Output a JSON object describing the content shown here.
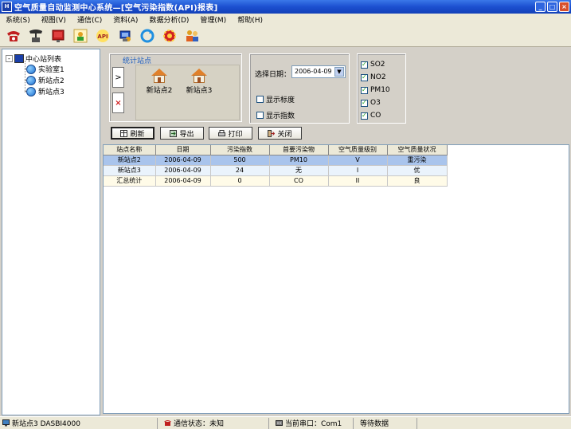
{
  "window": {
    "app_icon_text": "H",
    "title": "空气质量自动监测中心系统—[空气污染指数(API)报表]",
    "minimize_label": "_",
    "maximize_label": "□",
    "close_label": "×"
  },
  "menu": {
    "items": [
      "系统(S)",
      "视图(V)",
      "通信(C)",
      "资料(A)",
      "数据分析(D)",
      "管理(M)",
      "帮助(H)"
    ]
  },
  "toolbar": {
    "buttons": [
      {
        "icon": "phone-icon",
        "color": "#c02020"
      },
      {
        "icon": "hangup-icon",
        "color": "#303030"
      },
      {
        "icon": "book-icon",
        "color": "#c02020"
      },
      {
        "icon": "person-icon",
        "color": "#e0a020"
      },
      {
        "icon": "api-icon",
        "color": "#e0a020"
      },
      {
        "icon": "network-icon",
        "color": "#2050c0"
      },
      {
        "icon": "refresh-icon",
        "color": "#2090e0"
      },
      {
        "icon": "gear-icon",
        "color": "#d02020"
      },
      {
        "icon": "users-icon",
        "color": "#e06020"
      }
    ]
  },
  "tree": {
    "root_label": "中心站列表",
    "toggle": "-",
    "children": [
      "实验室1",
      "新站点2",
      "新站点3"
    ]
  },
  "stats_group": {
    "label": "统计站点",
    "add_button": ">",
    "remove_button": "×",
    "sites": [
      "新站点2",
      "新站点3"
    ]
  },
  "date_group": {
    "label": "选择日期：",
    "value": "2006-04-09",
    "dropdown": "▼",
    "show_stat_label": "显示标度",
    "show_index_label": "显示指数"
  },
  "pollutants": [
    {
      "label": "SO2",
      "checked": true
    },
    {
      "label": "NO2",
      "checked": true
    },
    {
      "label": "PM10",
      "checked": true
    },
    {
      "label": "O3",
      "checked": true
    },
    {
      "label": "CO",
      "checked": true
    }
  ],
  "actions": {
    "query": "刷新",
    "export": "导出",
    "print": "打印",
    "close": "关闭"
  },
  "grid": {
    "columns": [
      "站点名称",
      "日期",
      "污染指数",
      "首要污染物",
      "空气质量级别",
      "空气质量状况"
    ],
    "rows": [
      [
        "新站点2",
        "2006-04-09",
        "500",
        "PM10",
        "V",
        "重污染"
      ],
      [
        "新站点3",
        "2006-04-09",
        "24",
        "无",
        "I",
        "优"
      ],
      [
        "汇总统计",
        "2006-04-09",
        "0",
        "CO",
        "II",
        "良"
      ]
    ]
  },
  "statusbar": {
    "station": "新站点3 DASBI4000",
    "comm_status": "通信状态：未知",
    "serial_port": "当前串口：Com1",
    "waiting": "等待数据"
  }
}
